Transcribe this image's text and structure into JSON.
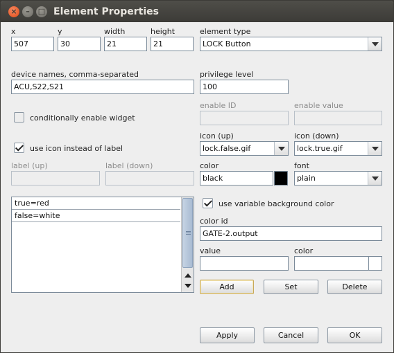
{
  "window": {
    "title": "Element Properties"
  },
  "geometry": {
    "x_label": "x",
    "x_value": "507",
    "y_label": "y",
    "y_value": "30",
    "width_label": "width",
    "width_value": "21",
    "height_label": "height",
    "height_value": "21"
  },
  "element_type": {
    "label": "element type",
    "value": "LOCK Button"
  },
  "device_names": {
    "label": "device names, comma-separated",
    "value": "ACU,S22,S21"
  },
  "privilege": {
    "label": "privilege level",
    "value": "100"
  },
  "enable": {
    "id_label": "enable ID",
    "id_value": "",
    "value_label": "enable value",
    "value_value": ""
  },
  "conditionally_enable": {
    "label": "conditionally enable widget",
    "checked": false
  },
  "use_icon": {
    "label": "use icon instead of label",
    "checked": true
  },
  "icon_up": {
    "label": "icon (up)",
    "value": "lock.false.gif"
  },
  "icon_down": {
    "label": "icon (down)",
    "value": "lock.true.gif"
  },
  "label_up": {
    "label": "label (up)",
    "value": ""
  },
  "label_down": {
    "label": "label (down)",
    "value": ""
  },
  "color": {
    "label": "color",
    "value": "black",
    "swatch": "#000000"
  },
  "font": {
    "label": "font",
    "value": "plain"
  },
  "value_list": {
    "items": [
      "true=red",
      "false=white"
    ]
  },
  "variable_bg": {
    "label": "use variable background color",
    "checked": true
  },
  "color_id": {
    "label": "color id",
    "value": "GATE-2.output"
  },
  "value_entry": {
    "value_label": "value",
    "value": "",
    "color_label": "color",
    "color_value": ""
  },
  "list_buttons": {
    "add": "Add",
    "set": "Set",
    "delete": "Delete"
  },
  "footer": {
    "apply": "Apply",
    "cancel": "Cancel",
    "ok": "OK"
  }
}
